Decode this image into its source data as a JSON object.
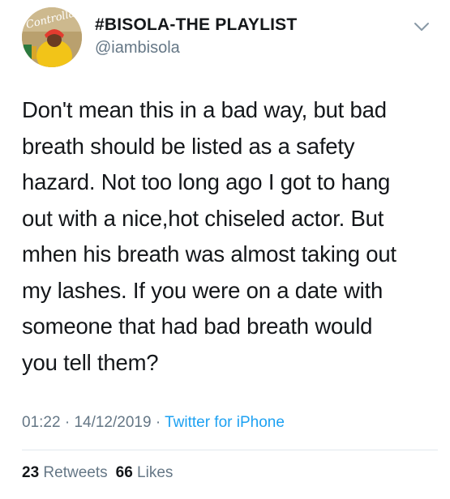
{
  "account": {
    "display_name": "#BISOLA-THE PLAYLIST",
    "handle": "@iambisola",
    "avatar_overlay_text": "Controlla"
  },
  "tweet": {
    "lines": [
      "Don't mean this in a bad way, but bad",
      "breath should be listed as a safety",
      "hazard. Not too long ago I got to hang",
      "out with a nice,hot chiseled actor. But",
      "mhen his breath was almost taking out",
      "my lashes. If you were on a date with",
      "someone that had bad breath would",
      "you tell them?"
    ],
    "time": "01:22",
    "separator": "·",
    "date": "14/12/2019",
    "source": "Twitter for iPhone"
  },
  "stats": {
    "retweets_count": "23",
    "retweets_label": "Retweets",
    "likes_count": "66",
    "likes_label": "Likes"
  },
  "colors": {
    "text": "#14171a",
    "secondary": "#657786",
    "link": "#1da1f2",
    "divider": "#e1e8ed"
  },
  "icons": {
    "menu": "chevron-down-icon"
  }
}
